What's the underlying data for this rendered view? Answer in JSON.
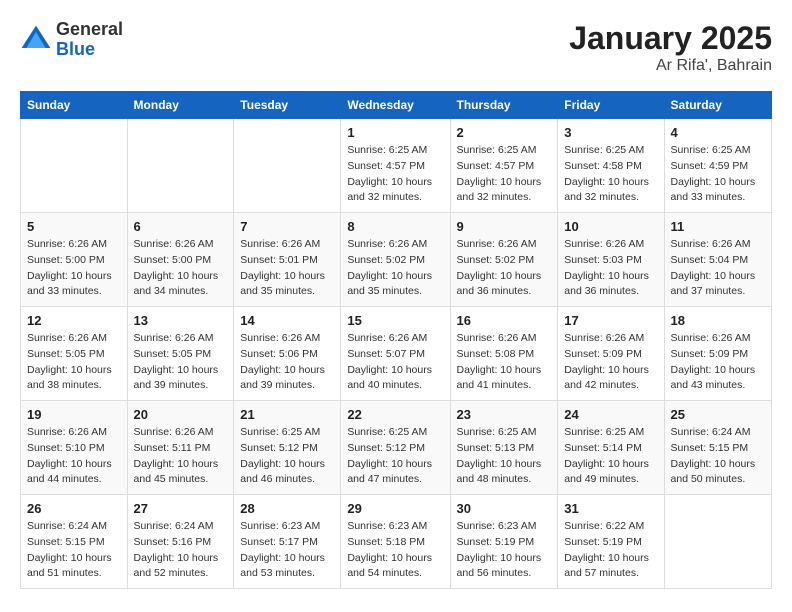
{
  "logo": {
    "general": "General",
    "blue": "Blue"
  },
  "title": "January 2025",
  "subtitle": "Ar Rifa', Bahrain",
  "days_of_week": [
    "Sunday",
    "Monday",
    "Tuesday",
    "Wednesday",
    "Thursday",
    "Friday",
    "Saturday"
  ],
  "weeks": [
    [
      {
        "day": "",
        "info": ""
      },
      {
        "day": "",
        "info": ""
      },
      {
        "day": "",
        "info": ""
      },
      {
        "day": "1",
        "info": "Sunrise: 6:25 AM\nSunset: 4:57 PM\nDaylight: 10 hours\nand 32 minutes."
      },
      {
        "day": "2",
        "info": "Sunrise: 6:25 AM\nSunset: 4:57 PM\nDaylight: 10 hours\nand 32 minutes."
      },
      {
        "day": "3",
        "info": "Sunrise: 6:25 AM\nSunset: 4:58 PM\nDaylight: 10 hours\nand 32 minutes."
      },
      {
        "day": "4",
        "info": "Sunrise: 6:25 AM\nSunset: 4:59 PM\nDaylight: 10 hours\nand 33 minutes."
      }
    ],
    [
      {
        "day": "5",
        "info": "Sunrise: 6:26 AM\nSunset: 5:00 PM\nDaylight: 10 hours\nand 33 minutes."
      },
      {
        "day": "6",
        "info": "Sunrise: 6:26 AM\nSunset: 5:00 PM\nDaylight: 10 hours\nand 34 minutes."
      },
      {
        "day": "7",
        "info": "Sunrise: 6:26 AM\nSunset: 5:01 PM\nDaylight: 10 hours\nand 35 minutes."
      },
      {
        "day": "8",
        "info": "Sunrise: 6:26 AM\nSunset: 5:02 PM\nDaylight: 10 hours\nand 35 minutes."
      },
      {
        "day": "9",
        "info": "Sunrise: 6:26 AM\nSunset: 5:02 PM\nDaylight: 10 hours\nand 36 minutes."
      },
      {
        "day": "10",
        "info": "Sunrise: 6:26 AM\nSunset: 5:03 PM\nDaylight: 10 hours\nand 36 minutes."
      },
      {
        "day": "11",
        "info": "Sunrise: 6:26 AM\nSunset: 5:04 PM\nDaylight: 10 hours\nand 37 minutes."
      }
    ],
    [
      {
        "day": "12",
        "info": "Sunrise: 6:26 AM\nSunset: 5:05 PM\nDaylight: 10 hours\nand 38 minutes."
      },
      {
        "day": "13",
        "info": "Sunrise: 6:26 AM\nSunset: 5:05 PM\nDaylight: 10 hours\nand 39 minutes."
      },
      {
        "day": "14",
        "info": "Sunrise: 6:26 AM\nSunset: 5:06 PM\nDaylight: 10 hours\nand 39 minutes."
      },
      {
        "day": "15",
        "info": "Sunrise: 6:26 AM\nSunset: 5:07 PM\nDaylight: 10 hours\nand 40 minutes."
      },
      {
        "day": "16",
        "info": "Sunrise: 6:26 AM\nSunset: 5:08 PM\nDaylight: 10 hours\nand 41 minutes."
      },
      {
        "day": "17",
        "info": "Sunrise: 6:26 AM\nSunset: 5:09 PM\nDaylight: 10 hours\nand 42 minutes."
      },
      {
        "day": "18",
        "info": "Sunrise: 6:26 AM\nSunset: 5:09 PM\nDaylight: 10 hours\nand 43 minutes."
      }
    ],
    [
      {
        "day": "19",
        "info": "Sunrise: 6:26 AM\nSunset: 5:10 PM\nDaylight: 10 hours\nand 44 minutes."
      },
      {
        "day": "20",
        "info": "Sunrise: 6:26 AM\nSunset: 5:11 PM\nDaylight: 10 hours\nand 45 minutes."
      },
      {
        "day": "21",
        "info": "Sunrise: 6:25 AM\nSunset: 5:12 PM\nDaylight: 10 hours\nand 46 minutes."
      },
      {
        "day": "22",
        "info": "Sunrise: 6:25 AM\nSunset: 5:12 PM\nDaylight: 10 hours\nand 47 minutes."
      },
      {
        "day": "23",
        "info": "Sunrise: 6:25 AM\nSunset: 5:13 PM\nDaylight: 10 hours\nand 48 minutes."
      },
      {
        "day": "24",
        "info": "Sunrise: 6:25 AM\nSunset: 5:14 PM\nDaylight: 10 hours\nand 49 minutes."
      },
      {
        "day": "25",
        "info": "Sunrise: 6:24 AM\nSunset: 5:15 PM\nDaylight: 10 hours\nand 50 minutes."
      }
    ],
    [
      {
        "day": "26",
        "info": "Sunrise: 6:24 AM\nSunset: 5:15 PM\nDaylight: 10 hours\nand 51 minutes."
      },
      {
        "day": "27",
        "info": "Sunrise: 6:24 AM\nSunset: 5:16 PM\nDaylight: 10 hours\nand 52 minutes."
      },
      {
        "day": "28",
        "info": "Sunrise: 6:23 AM\nSunset: 5:17 PM\nDaylight: 10 hours\nand 53 minutes."
      },
      {
        "day": "29",
        "info": "Sunrise: 6:23 AM\nSunset: 5:18 PM\nDaylight: 10 hours\nand 54 minutes."
      },
      {
        "day": "30",
        "info": "Sunrise: 6:23 AM\nSunset: 5:19 PM\nDaylight: 10 hours\nand 56 minutes."
      },
      {
        "day": "31",
        "info": "Sunrise: 6:22 AM\nSunset: 5:19 PM\nDaylight: 10 hours\nand 57 minutes."
      },
      {
        "day": "",
        "info": ""
      }
    ]
  ]
}
